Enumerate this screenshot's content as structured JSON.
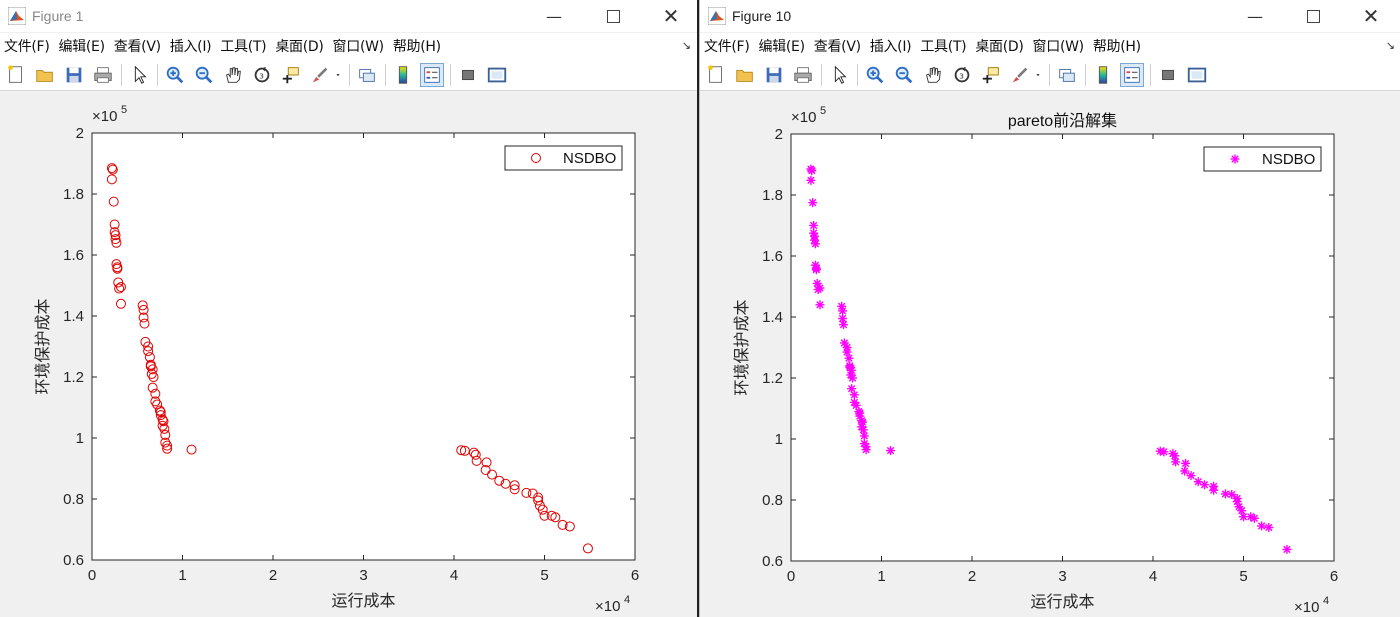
{
  "windows": [
    {
      "title": "Figure 1",
      "menus": [
        "文件(F)",
        "编辑(E)",
        "查看(V)",
        "插入(I)",
        "工具(T)",
        "桌面(D)",
        "窗口(W)",
        "帮助(H)"
      ],
      "active": false
    },
    {
      "title": "Figure 10",
      "menus": [
        "文件(F)",
        "编辑(E)",
        "查看(V)",
        "插入(I)",
        "工具(T)",
        "桌面(D)",
        "窗口(W)",
        "帮助(H)"
      ],
      "active": true
    }
  ],
  "toolbar_icons": [
    "new-figure-icon",
    "open-file-icon",
    "save-icon",
    "print-icon",
    "select-pointer-icon",
    "zoom-in-icon",
    "zoom-out-icon",
    "pan-hand-icon",
    "rotate-3d-icon",
    "data-cursor-icon",
    "brush-icon",
    "brush-dropdown-icon",
    "link-plot-icon",
    "colorbar-icon",
    "legend-icon",
    "hide-plot-tools-icon",
    "show-plot-tools-icon"
  ],
  "colors": {
    "series1": "#e00000",
    "series2": "#ff00ff"
  },
  "chart_data": [
    {
      "type": "scatter",
      "title": "",
      "xlabel": "运行成本",
      "ylabel": "环境保护成本",
      "x_exponent": "×10",
      "x_exponent_power": "4",
      "y_exponent": "×10",
      "y_exponent_power": "5",
      "xlim": [
        0,
        6
      ],
      "ylim": [
        0.6,
        2
      ],
      "xticks": [
        "0",
        "1",
        "2",
        "3",
        "4",
        "5",
        "6"
      ],
      "yticks": [
        "0.6",
        "0.8",
        "1",
        "1.2",
        "1.4",
        "1.6",
        "1.8",
        "2"
      ],
      "marker": "circle",
      "legend": "NSDBO",
      "legend_position": "top-right",
      "grid": false,
      "series": [
        {
          "name": "NSDBO",
          "points": [
            [
              0.22,
              1.885
            ],
            [
              0.23,
              1.88
            ],
            [
              0.22,
              1.848
            ],
            [
              0.24,
              1.775
            ],
            [
              0.25,
              1.7
            ],
            [
              0.25,
              1.675
            ],
            [
              0.26,
              1.665
            ],
            [
              0.26,
              1.652
            ],
            [
              0.27,
              1.64
            ],
            [
              0.27,
              1.57
            ],
            [
              0.28,
              1.56
            ],
            [
              0.28,
              1.555
            ],
            [
              0.29,
              1.51
            ],
            [
              0.3,
              1.49
            ],
            [
              0.32,
              1.495
            ],
            [
              0.32,
              1.44
            ],
            [
              0.56,
              1.435
            ],
            [
              0.57,
              1.42
            ],
            [
              0.57,
              1.395
            ],
            [
              0.58,
              1.375
            ],
            [
              0.59,
              1.315
            ],
            [
              0.62,
              1.3
            ],
            [
              0.62,
              1.285
            ],
            [
              0.64,
              1.265
            ],
            [
              0.65,
              1.24
            ],
            [
              0.65,
              1.235
            ],
            [
              0.67,
              1.225
            ],
            [
              0.66,
              1.21
            ],
            [
              0.68,
              1.2
            ],
            [
              0.67,
              1.165
            ],
            [
              0.7,
              1.145
            ],
            [
              0.7,
              1.12
            ],
            [
              0.72,
              1.11
            ],
            [
              0.75,
              1.09
            ],
            [
              0.76,
              1.085
            ],
            [
              0.76,
              1.075
            ],
            [
              0.78,
              1.06
            ],
            [
              0.79,
              1.055
            ],
            [
              0.78,
              1.04
            ],
            [
              0.8,
              1.03
            ],
            [
              0.81,
              1.01
            ],
            [
              0.81,
              0.985
            ],
            [
              0.83,
              0.975
            ],
            [
              0.83,
              0.965
            ],
            [
              1.1,
              0.962
            ],
            [
              4.08,
              0.96
            ],
            [
              4.12,
              0.958
            ],
            [
              4.22,
              0.952
            ],
            [
              4.24,
              0.945
            ],
            [
              4.25,
              0.925
            ],
            [
              4.36,
              0.92
            ],
            [
              4.35,
              0.895
            ],
            [
              4.42,
              0.88
            ],
            [
              4.5,
              0.86
            ],
            [
              4.57,
              0.85
            ],
            [
              4.67,
              0.845
            ],
            [
              4.67,
              0.832
            ],
            [
              4.8,
              0.82
            ],
            [
              4.87,
              0.818
            ],
            [
              4.93,
              0.805
            ],
            [
              4.93,
              0.795
            ],
            [
              4.95,
              0.778
            ],
            [
              4.98,
              0.765
            ],
            [
              5.0,
              0.745
            ],
            [
              5.08,
              0.745
            ],
            [
              5.12,
              0.74
            ],
            [
              5.2,
              0.715
            ],
            [
              5.28,
              0.71
            ],
            [
              5.48,
              0.638
            ]
          ]
        }
      ]
    },
    {
      "type": "scatter",
      "title": "pareto前沿解集",
      "xlabel": "运行成本",
      "ylabel": "环境保护成本",
      "x_exponent": "×10",
      "x_exponent_power": "4",
      "y_exponent": "×10",
      "y_exponent_power": "5",
      "xlim": [
        0,
        6
      ],
      "ylim": [
        0.6,
        2
      ],
      "xticks": [
        "0",
        "1",
        "2",
        "3",
        "4",
        "5",
        "6"
      ],
      "yticks": [
        "0.6",
        "0.8",
        "1",
        "1.2",
        "1.4",
        "1.6",
        "1.8",
        "2"
      ],
      "marker": "asterisk",
      "legend": "NSDBO",
      "legend_position": "top-right",
      "grid": false,
      "series": [
        {
          "name": "NSDBO",
          "points": [
            [
              0.22,
              1.885
            ],
            [
              0.23,
              1.88
            ],
            [
              0.22,
              1.848
            ],
            [
              0.24,
              1.775
            ],
            [
              0.25,
              1.7
            ],
            [
              0.25,
              1.675
            ],
            [
              0.26,
              1.665
            ],
            [
              0.26,
              1.652
            ],
            [
              0.27,
              1.64
            ],
            [
              0.27,
              1.57
            ],
            [
              0.28,
              1.56
            ],
            [
              0.28,
              1.555
            ],
            [
              0.29,
              1.51
            ],
            [
              0.3,
              1.49
            ],
            [
              0.32,
              1.495
            ],
            [
              0.32,
              1.44
            ],
            [
              0.56,
              1.435
            ],
            [
              0.57,
              1.42
            ],
            [
              0.57,
              1.395
            ],
            [
              0.58,
              1.375
            ],
            [
              0.59,
              1.315
            ],
            [
              0.62,
              1.3
            ],
            [
              0.62,
              1.285
            ],
            [
              0.64,
              1.265
            ],
            [
              0.65,
              1.24
            ],
            [
              0.65,
              1.235
            ],
            [
              0.67,
              1.225
            ],
            [
              0.66,
              1.21
            ],
            [
              0.68,
              1.2
            ],
            [
              0.67,
              1.165
            ],
            [
              0.7,
              1.145
            ],
            [
              0.7,
              1.12
            ],
            [
              0.72,
              1.11
            ],
            [
              0.75,
              1.09
            ],
            [
              0.76,
              1.085
            ],
            [
              0.76,
              1.075
            ],
            [
              0.78,
              1.06
            ],
            [
              0.79,
              1.055
            ],
            [
              0.78,
              1.04
            ],
            [
              0.8,
              1.03
            ],
            [
              0.81,
              1.01
            ],
            [
              0.81,
              0.985
            ],
            [
              0.83,
              0.975
            ],
            [
              0.83,
              0.965
            ],
            [
              1.1,
              0.962
            ],
            [
              4.08,
              0.96
            ],
            [
              4.12,
              0.958
            ],
            [
              4.22,
              0.952
            ],
            [
              4.24,
              0.945
            ],
            [
              4.25,
              0.925
            ],
            [
              4.36,
              0.92
            ],
            [
              4.35,
              0.895
            ],
            [
              4.42,
              0.88
            ],
            [
              4.5,
              0.86
            ],
            [
              4.57,
              0.85
            ],
            [
              4.67,
              0.845
            ],
            [
              4.67,
              0.832
            ],
            [
              4.8,
              0.82
            ],
            [
              4.87,
              0.818
            ],
            [
              4.93,
              0.805
            ],
            [
              4.93,
              0.795
            ],
            [
              4.95,
              0.778
            ],
            [
              4.98,
              0.765
            ],
            [
              5.0,
              0.745
            ],
            [
              5.08,
              0.745
            ],
            [
              5.12,
              0.74
            ],
            [
              5.2,
              0.715
            ],
            [
              5.28,
              0.71
            ],
            [
              5.48,
              0.638
            ]
          ]
        }
      ]
    }
  ]
}
